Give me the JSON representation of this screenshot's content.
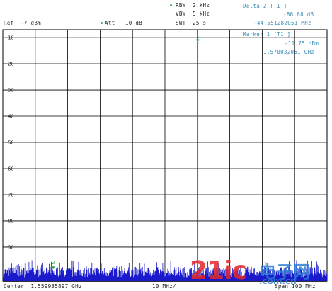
{
  "header": {
    "ref_label": "Ref  -7 dBm",
    "att_label": "Att   10 dB",
    "rbw_label": "RBW  2 kHz",
    "vbw_label": "VBW  5 kHz",
    "swt_label": "SWT  25 s",
    "delta_title": "Delta 2 [T1 ]",
    "delta_level": "-86.68 dB",
    "delta_freq": "-44.551282051 MHz",
    "marker_title": "Marker 1 [T1 ]",
    "marker_level": "-11.75 dBm",
    "marker_freq": "1.570032051 GHz"
  },
  "y_axis": {
    "ticks": [
      "-10",
      "-20",
      "-30",
      "-40",
      "-50",
      "-60",
      "-70",
      "-80",
      "-90"
    ],
    "range_dbm": [
      -7,
      -103
    ]
  },
  "footer": {
    "center_label": "Center  1.559935897 GHz",
    "span_div_label": "10 MHz/",
    "span_label": "Span 100 MHz"
  },
  "markers": [
    {
      "id": "1",
      "label": "1",
      "freq_ghz": 1.570032051,
      "level_dbm": -11.75
    },
    {
      "id": "2",
      "label": "2",
      "freq_ghz": 1.525480769,
      "level_dbm": -98.43
    }
  ],
  "colors": {
    "trace": "#1a1acc",
    "grid": "#000000",
    "marker_green": "#33b04a",
    "header_blue": "#3a8fb7",
    "watermark_red": "#e62828"
  },
  "watermark": {
    "text": "21ic",
    "sub": "电子网",
    "domain": ".com.cn"
  }
}
